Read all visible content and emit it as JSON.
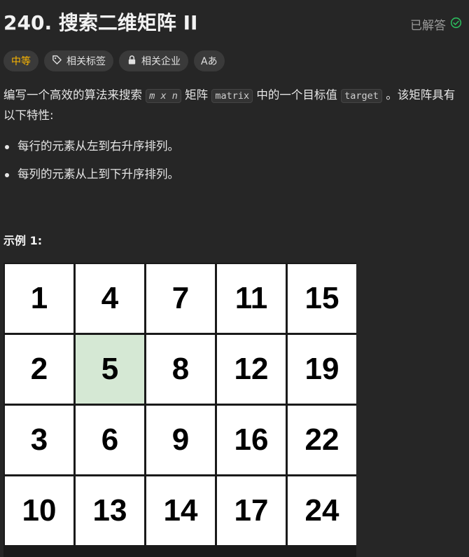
{
  "problem": {
    "title": "240. 搜索二维矩阵 II",
    "status": "已解答"
  },
  "tags": {
    "difficulty": "中等",
    "related_tags": "相关标签",
    "related_companies": "相关企业",
    "translate": "Aあ"
  },
  "description": {
    "part1": "编写一个高效的算法来搜索",
    "code_dims": "m x n",
    "part2": "矩阵",
    "code_matrix": "matrix",
    "part3": "中的一个目标值",
    "code_target": "target",
    "part4": "。该矩阵具有以下特性:"
  },
  "features": [
    "每行的元素从左到右升序排列。",
    "每列的元素从上到下升序排列。"
  ],
  "example": {
    "label": "示例 1:",
    "matrix": [
      [
        "1",
        "4",
        "7",
        "11",
        "15"
      ],
      [
        "2",
        "5",
        "8",
        "12",
        "19"
      ],
      [
        "3",
        "6",
        "9",
        "16",
        "22"
      ],
      [
        "10",
        "13",
        "14",
        "17",
        "24"
      ]
    ],
    "highlight_value": "5",
    "highlight_color": "#d5e8d4"
  },
  "colors": {
    "background": "#262626",
    "difficulty": "#ffb800",
    "solved_check": "#2cbb5d"
  }
}
